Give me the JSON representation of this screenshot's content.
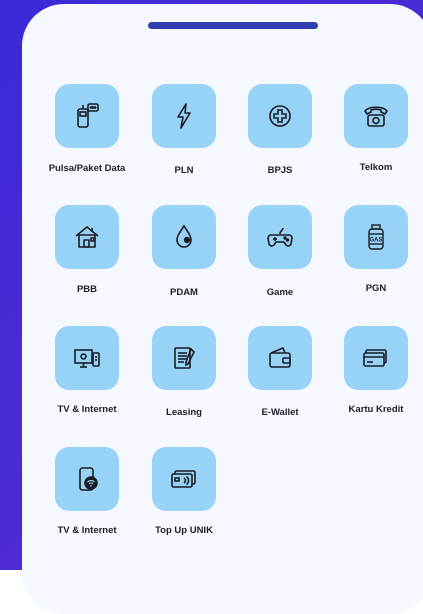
{
  "items": [
    {
      "label": "Pulsa/Paket Data",
      "icon": "mobile-phone-icon"
    },
    {
      "label": "PLN",
      "icon": "lightning-icon"
    },
    {
      "label": "BPJS",
      "icon": "medical-cross-icon"
    },
    {
      "label": "Telkom",
      "icon": "telephone-icon"
    },
    {
      "label": "PBB",
      "icon": "house-icon"
    },
    {
      "label": "PDAM",
      "icon": "water-drop-icon"
    },
    {
      "label": "Game",
      "icon": "gamepad-icon"
    },
    {
      "label": "PGN",
      "icon": "gas-cylinder-icon"
    },
    {
      "label": "TV & Internet",
      "icon": "tv-icon"
    },
    {
      "label": "Leasing",
      "icon": "document-icon"
    },
    {
      "label": "E-Wallet",
      "icon": "wallet-icon"
    },
    {
      "label": "Kartu Kredit",
      "icon": "credit-card-icon"
    },
    {
      "label": "TV & Internet",
      "icon": "smartphone-wifi-icon"
    },
    {
      "label": "Top Up UNIK",
      "icon": "contactless-card-icon"
    }
  ],
  "colors": {
    "background": "#4a2bd3",
    "sheet": "#f5f8ff",
    "handle": "#2f3fb0",
    "tile": "#97d3f7"
  },
  "texts": {
    "gas_label": "GAS"
  }
}
